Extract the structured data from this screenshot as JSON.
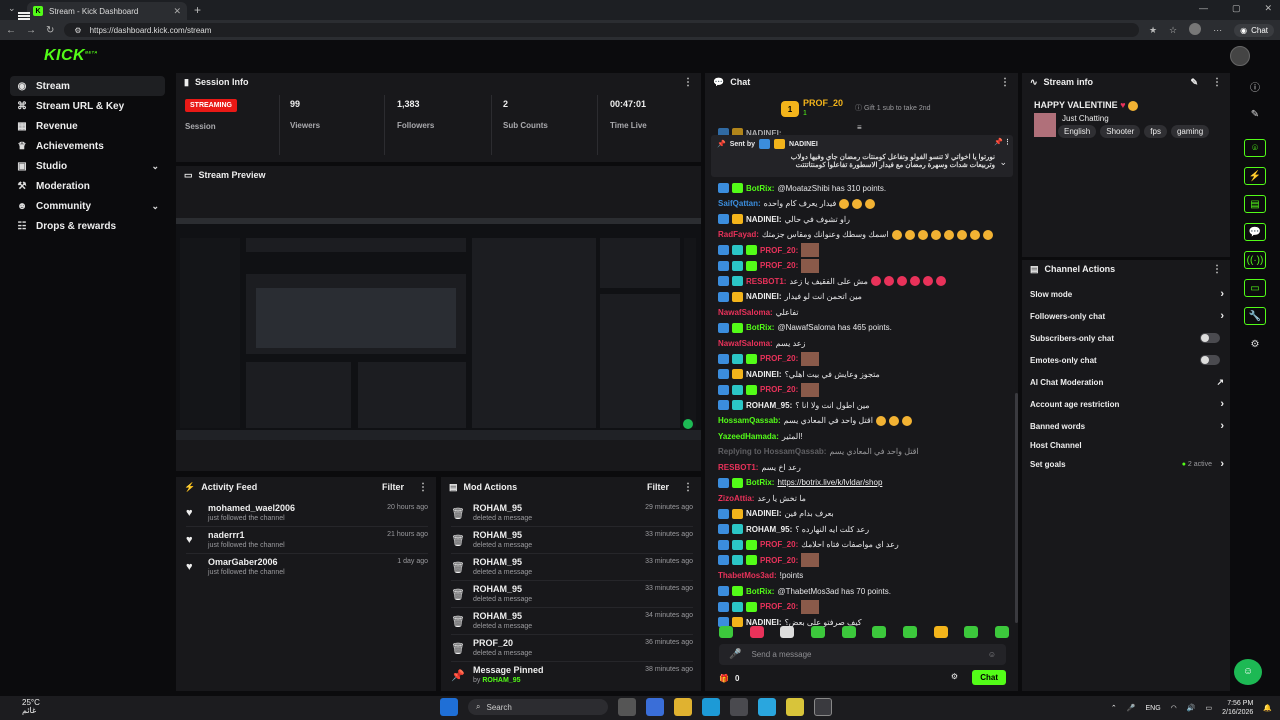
{
  "browser": {
    "tab_title": "Stream - Kick Dashboard",
    "url": "https://dashboard.kick.com/stream",
    "chat_button": "Chat"
  },
  "app": {
    "logo": "KICK",
    "logo_sup": "BETA"
  },
  "sidebar": {
    "items": [
      {
        "label": "Stream",
        "icon": "broadcast-icon"
      },
      {
        "label": "Stream URL & Key",
        "icon": "key-icon"
      },
      {
        "label": "Revenue",
        "icon": "revenue-icon"
      },
      {
        "label": "Achievements",
        "icon": "trophy-icon"
      },
      {
        "label": "Studio",
        "icon": "studio-icon"
      },
      {
        "label": "Moderation",
        "icon": "hammer-icon"
      },
      {
        "label": "Community",
        "icon": "people-icon"
      },
      {
        "label": "Drops & rewards",
        "icon": "gift-icon"
      }
    ]
  },
  "session": {
    "title": "Session Info",
    "status": "STREAMING",
    "status_label": "Session",
    "viewers": "99",
    "viewers_label": "Viewers",
    "followers": "1,383",
    "followers_label": "Followers",
    "subs": "2",
    "subs_label": "Sub Counts",
    "time": "00:47:01",
    "time_label": "Time Live"
  },
  "preview": {
    "title": "Stream Preview"
  },
  "activity": {
    "title": "Activity Feed",
    "filter": "Filter",
    "rows": [
      {
        "name": "mohamed_wael2006",
        "sub": "just followed the channel",
        "time": "20 hours ago"
      },
      {
        "name": "naderrr1",
        "sub": "just followed the channel",
        "time": "21 hours ago"
      },
      {
        "name": "OmarGaber2006",
        "sub": "just followed the channel",
        "time": "1 day ago"
      }
    ]
  },
  "mod": {
    "title": "Mod Actions",
    "filter": "Filter",
    "rows": [
      {
        "name": "ROHAM_95",
        "sub": "deleted a message",
        "time": "29 minutes ago"
      },
      {
        "name": "ROHAM_95",
        "sub": "deleted a message",
        "time": "33 minutes ago"
      },
      {
        "name": "ROHAM_95",
        "sub": "deleted a message",
        "time": "33 minutes ago"
      },
      {
        "name": "ROHAM_95",
        "sub": "deleted a message",
        "time": "33 minutes ago"
      },
      {
        "name": "ROHAM_95",
        "sub": "deleted a message",
        "time": "34 minutes ago"
      },
      {
        "name": "PROF_20",
        "sub": "deleted a message",
        "time": "36 minutes ago"
      },
      {
        "name": "Message Pinned",
        "sub_prefix": "by",
        "sub": "ROHAM_95",
        "time": "38 minutes ago"
      }
    ]
  },
  "chat": {
    "title": "Chat",
    "gifter": "PROF_20",
    "gifter_count": "1",
    "gift_text": "Gift 1 sub to take 2nd",
    "cut_top": "NADINEI:",
    "pinned_by_label": "Sent by",
    "pinned_user": "NADINEI",
    "pinned_line1": "نورتوا يا اخواتي لا تنسو الفولو وتفاعل كومنتات رمضان جاي وفيها دولاب",
    "pinned_line2": "وتربيعات شدات وسهرة رمضان مع فيدار الاسطورة تفاعلوا كومنتاتتتت",
    "messages": [
      {
        "user": "BotRix:",
        "color": "#53fc18",
        "text": "@MoatazShibi has 310 points.",
        "badges": "bg"
      },
      {
        "user": "SaifQattan:",
        "color": "#3b8ddd",
        "text": "فيدار يعرف كام واحده",
        "badges": "",
        "emos": 3
      },
      {
        "user": "NADINEI:",
        "color": "#eeeeee",
        "text": "راو تشوف في حالي",
        "badges": "by"
      },
      {
        "user": "RadFayad:",
        "color": "#e8325a",
        "text": "اسمك وسطك وعنوانك ومقاس جزمتك",
        "badges": "",
        "emos": 8
      },
      {
        "user": "PROF_20:",
        "color": "#e8325a",
        "text": "",
        "badges": "bmg",
        "thumb": true
      },
      {
        "user": "PROF_20:",
        "color": "#e8325a",
        "text": "",
        "badges": "bmg",
        "thumb": true
      },
      {
        "user": "RESBOT1:",
        "color": "#e8325a",
        "text": "مش على الفقيف يا زعد",
        "badges": "bm",
        "remos": 6
      },
      {
        "user": "NADINEI:",
        "color": "#eeeeee",
        "text": "مين اتحمن انت لو فيدار",
        "badges": "by"
      },
      {
        "user": "NawafSaloma:",
        "color": "#e8325a",
        "text": "تفاعلي",
        "badges": ""
      },
      {
        "user": "BotRix:",
        "color": "#53fc18",
        "text": "@NawafSaloma has 465 points.",
        "badges": "bg"
      },
      {
        "user": "NawafSaloma:",
        "color": "#e8325a",
        "text": "زعد يسم",
        "badges": ""
      },
      {
        "user": "PROF_20:",
        "color": "#e8325a",
        "text": "",
        "badges": "bmg",
        "thumb": true
      },
      {
        "user": "NADINEI:",
        "color": "#eeeeee",
        "text": "متجوز وعايش في بيت اهلي؟",
        "badges": "by"
      },
      {
        "user": "PROF_20:",
        "color": "#e8325a",
        "text": "",
        "badges": "bmg",
        "thumb": true
      },
      {
        "user": "ROHAM_95:",
        "color": "#eeeeee",
        "text": "مين اطول انت ولا انا ؟",
        "badges": "bm"
      },
      {
        "user": "HossamQassab:",
        "color": "#53fc18",
        "text": "اقتل واحد في المعادي يسم",
        "badges": "",
        "emos": 3
      },
      {
        "user": "YazeedHamada:",
        "color": "#53fc18",
        "text": "المثير!",
        "badges": ""
      },
      {
        "user": "Replying to HossamQassab:",
        "color": "#8e8e92",
        "text": "اقتل واحد في المعادي يسم",
        "badges": "",
        "reply": true
      },
      {
        "user": "RESBOT1:",
        "color": "#e8325a",
        "text": "رعد اخ يسم",
        "badges": ""
      },
      {
        "user": "BotRix:",
        "color": "#53fc18",
        "text": "https://botrix.live/k/lvldar/shop",
        "badges": "bg",
        "link": true
      },
      {
        "user": "ZizoAttia:",
        "color": "#e8325a",
        "text": "ما تخش يا رعد",
        "badges": ""
      },
      {
        "user": "NADINEI:",
        "color": "#eeeeee",
        "text": "بعرف بدام فين",
        "badges": "by"
      },
      {
        "user": "ROHAM_95:",
        "color": "#eeeeee",
        "text": "رعد كلت ايه النهارده ؟",
        "badges": "bm"
      },
      {
        "user": "PROF_20:",
        "color": "#e8325a",
        "text": "رعد اي مواصفات فتاه احلامك",
        "badges": "bmg"
      },
      {
        "user": "PROF_20:",
        "color": "#e8325a",
        "text": "",
        "badges": "bmg",
        "thumb": true
      },
      {
        "user": "ThabetMos3ad:",
        "color": "#e8325a",
        "text": "!points",
        "badges": ""
      },
      {
        "user": "BotRix:",
        "color": "#53fc18",
        "text": "@ThabetMos3ad has 70 points.",
        "badges": "bg"
      },
      {
        "user": "PROF_20:",
        "color": "#e8325a",
        "text": "",
        "badges": "bmg",
        "thumb": true
      },
      {
        "user": "NADINEI:",
        "color": "#eeeeee",
        "text": "كيف صرفتو على بعض؟",
        "badges": "by"
      }
    ],
    "input_placeholder": "Send a message",
    "count": "0",
    "send_label": "Chat"
  },
  "stream_info": {
    "title": "Stream info",
    "stream_title": "HAPPY VALENTINE",
    "category": "Just Chatting",
    "tags": [
      "English",
      "Shooter",
      "fps",
      "gaming"
    ]
  },
  "channel_actions": {
    "title": "Channel Actions",
    "rows": [
      {
        "label": "Slow mode",
        "control": "chevron"
      },
      {
        "label": "Followers-only chat",
        "control": "chevron"
      },
      {
        "label": "Subscribers-only chat",
        "control": "toggle"
      },
      {
        "label": "Emotes-only chat",
        "control": "toggle"
      },
      {
        "label": "AI Chat Moderation",
        "control": "chart"
      },
      {
        "label": "Account age restriction",
        "control": "chevron"
      },
      {
        "label": "Banned words",
        "control": "chevron"
      },
      {
        "label": "Host Channel",
        "control": "none"
      },
      {
        "label": "Set goals",
        "control": "status",
        "status": "2 active"
      }
    ]
  },
  "taskbar": {
    "temp": "25°C",
    "weather_sub": "غائم",
    "search": "Search",
    "lang": "ENG",
    "time": "7:56 PM",
    "date": "2/16/2026"
  },
  "colors": {
    "accent": "#53fc18",
    "live": "#e91916",
    "panel": "#18181b"
  }
}
